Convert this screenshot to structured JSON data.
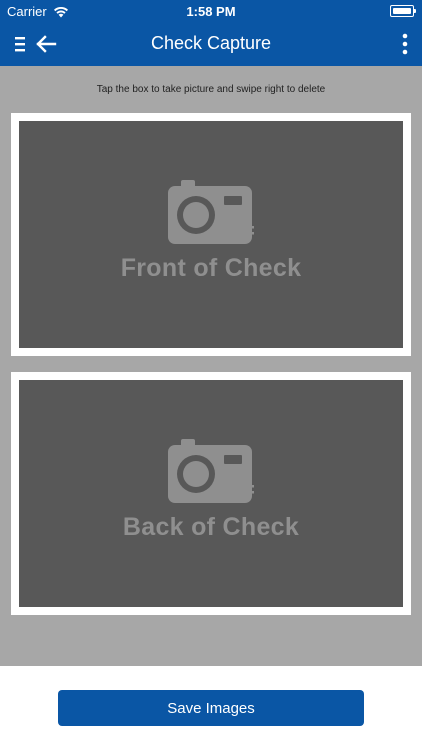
{
  "status_bar": {
    "carrier": "Carrier",
    "time": "1:58 PM"
  },
  "nav": {
    "title": "Check Capture",
    "menu_icon": "menu-icon",
    "back_icon": "back-arrow-icon",
    "more_icon": "more-vertical-icon"
  },
  "instruction": "Tap the box to take picture and swipe right to delete",
  "front_card": {
    "label": "Front of Check",
    "icon": "camera-icon"
  },
  "back_card": {
    "label": "Back of Check",
    "icon": "camera-icon"
  },
  "footer": {
    "save_label": "Save Images"
  },
  "colors": {
    "brand_blue": "#0a56a5",
    "content_background": "#a7a7a7",
    "placeholder_background": "#585858",
    "placeholder_text": "#8f8f8f"
  }
}
